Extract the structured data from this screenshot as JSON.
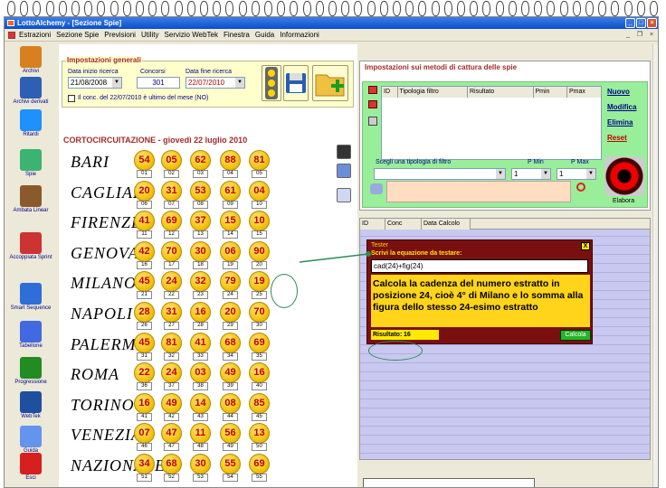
{
  "window": {
    "title": "LottoAlchemy - [Sezione Spie]"
  },
  "menu": [
    "Estrazioni",
    "Sezione Spie",
    "Previsioni",
    "Utility",
    "Servizio WebTek",
    "Finestra",
    "Guida",
    "Informazioni"
  ],
  "sidebar": [
    {
      "label": "Archivi",
      "icon": "pencil-icon",
      "color": "#d88020"
    },
    {
      "label": "Archivi derivati",
      "icon": "archive-icon",
      "color": "#2d5fb5"
    },
    {
      "label": "Ritardi",
      "icon": "clock-icon",
      "color": "#1e90ff"
    },
    {
      "label": "Spie",
      "icon": "flashlight-icon",
      "color": "#3cb371"
    },
    {
      "label": "Ambata Linear",
      "icon": "letter-a-icon",
      "color": "#8b5a2b"
    },
    {
      "label": "Accoppiata Sprint",
      "icon": "arrows-icon",
      "color": "#cc3333"
    },
    {
      "label": "Smart Sequence",
      "icon": "shield-icon",
      "color": "#2e6ed8"
    },
    {
      "label": "Tabellone",
      "icon": "table-icon",
      "color": "#4169e1"
    },
    {
      "label": "Progressione",
      "icon": "dollar-icon",
      "color": "#228b22"
    },
    {
      "label": "WebTek",
      "icon": "webtek-icon",
      "color": "#1e50a0"
    },
    {
      "label": "Guida",
      "icon": "book-icon",
      "color": "#6495ed"
    },
    {
      "label": "Esci",
      "icon": "exit-icon",
      "color": "#d62020"
    }
  ],
  "generali": {
    "title": "Impostazioni generali",
    "data_inizio_label": "Data inizio ricerca",
    "data_inizio": "21/08/2008",
    "concorsi_label": "Concorsi",
    "concorsi": "301",
    "data_fine_label": "Data fine ricerca",
    "data_fine": "22/07/2010",
    "checkbox_label": "Il conc. del 22/07/2010 è ultimo del mese (NO)"
  },
  "cortocircuitazione": {
    "title": "CORTOCIRCUITAZIONE - giovedì 22 luglio 2010"
  },
  "wheels": [
    {
      "name": "BARI",
      "numbers": [
        "54",
        "05",
        "62",
        "88",
        "81"
      ],
      "positions": [
        "01",
        "02",
        "03",
        "04",
        "05"
      ]
    },
    {
      "name": "CAGLIARI",
      "numbers": [
        "20",
        "31",
        "53",
        "61",
        "04"
      ],
      "positions": [
        "06",
        "07",
        "08",
        "09",
        "10"
      ]
    },
    {
      "name": "FIRENZE",
      "numbers": [
        "41",
        "69",
        "37",
        "15",
        "10"
      ],
      "positions": [
        "11",
        "12",
        "13",
        "14",
        "15"
      ]
    },
    {
      "name": "GENOVA",
      "numbers": [
        "42",
        "70",
        "30",
        "06",
        "90"
      ],
      "positions": [
        "16",
        "17",
        "18",
        "19",
        "20"
      ]
    },
    {
      "name": "MILANO",
      "numbers": [
        "45",
        "24",
        "32",
        "79",
        "19"
      ],
      "positions": [
        "21",
        "22",
        "23",
        "24",
        "25"
      ]
    },
    {
      "name": "NAPOLI",
      "numbers": [
        "28",
        "31",
        "16",
        "20",
        "70"
      ],
      "positions": [
        "26",
        "27",
        "28",
        "29",
        "30"
      ]
    },
    {
      "name": "PALERMO",
      "numbers": [
        "45",
        "81",
        "41",
        "68",
        "69"
      ],
      "positions": [
        "31",
        "32",
        "33",
        "34",
        "35"
      ]
    },
    {
      "name": "ROMA",
      "numbers": [
        "22",
        "24",
        "03",
        "49",
        "16"
      ],
      "positions": [
        "36",
        "37",
        "38",
        "39",
        "40"
      ]
    },
    {
      "name": "TORINO",
      "numbers": [
        "16",
        "49",
        "14",
        "08",
        "85"
      ],
      "positions": [
        "41",
        "42",
        "43",
        "44",
        "45"
      ]
    },
    {
      "name": "VENEZIA",
      "numbers": [
        "07",
        "47",
        "11",
        "56",
        "13"
      ],
      "positions": [
        "46",
        "47",
        "48",
        "49",
        "50"
      ]
    },
    {
      "name": "NAZIONALE",
      "numbers": [
        "34",
        "68",
        "30",
        "55",
        "69"
      ],
      "positions": [
        "51",
        "52",
        "53",
        "54",
        "55"
      ]
    }
  ],
  "metodi": {
    "title": "Impostazioni sui metodi di cattura delle spie",
    "columns": [
      "ID",
      "Tipologia filtro",
      "Risultato",
      "Pmin",
      "Pmax"
    ],
    "links": [
      "Nuovo",
      "Modifica",
      "Elimina",
      "Reset"
    ],
    "filter_label": "Scegli una tipologia di filtro",
    "pmin_label": "P Min",
    "pmax_label": "P Max",
    "pmin": "1",
    "pmax": "1",
    "elabora_label": "Elabora"
  },
  "grid": {
    "columns": [
      "ID",
      "Conc",
      "Data Calcolo"
    ]
  },
  "tester": {
    "title": "Tester",
    "close": "X",
    "prompt": "Scrivi la equazione da testare:",
    "equation": "cad(24)+fig(24)",
    "explanation": "Calcola la cadenza del numero estratto in posizione 24, cioè 4° di Milano e lo somma alla figura dello stesso 24-esimo estratto",
    "result_label": "Risultato:",
    "result": "16",
    "calc_button": "Calcola"
  },
  "bottom_status": "..."
}
